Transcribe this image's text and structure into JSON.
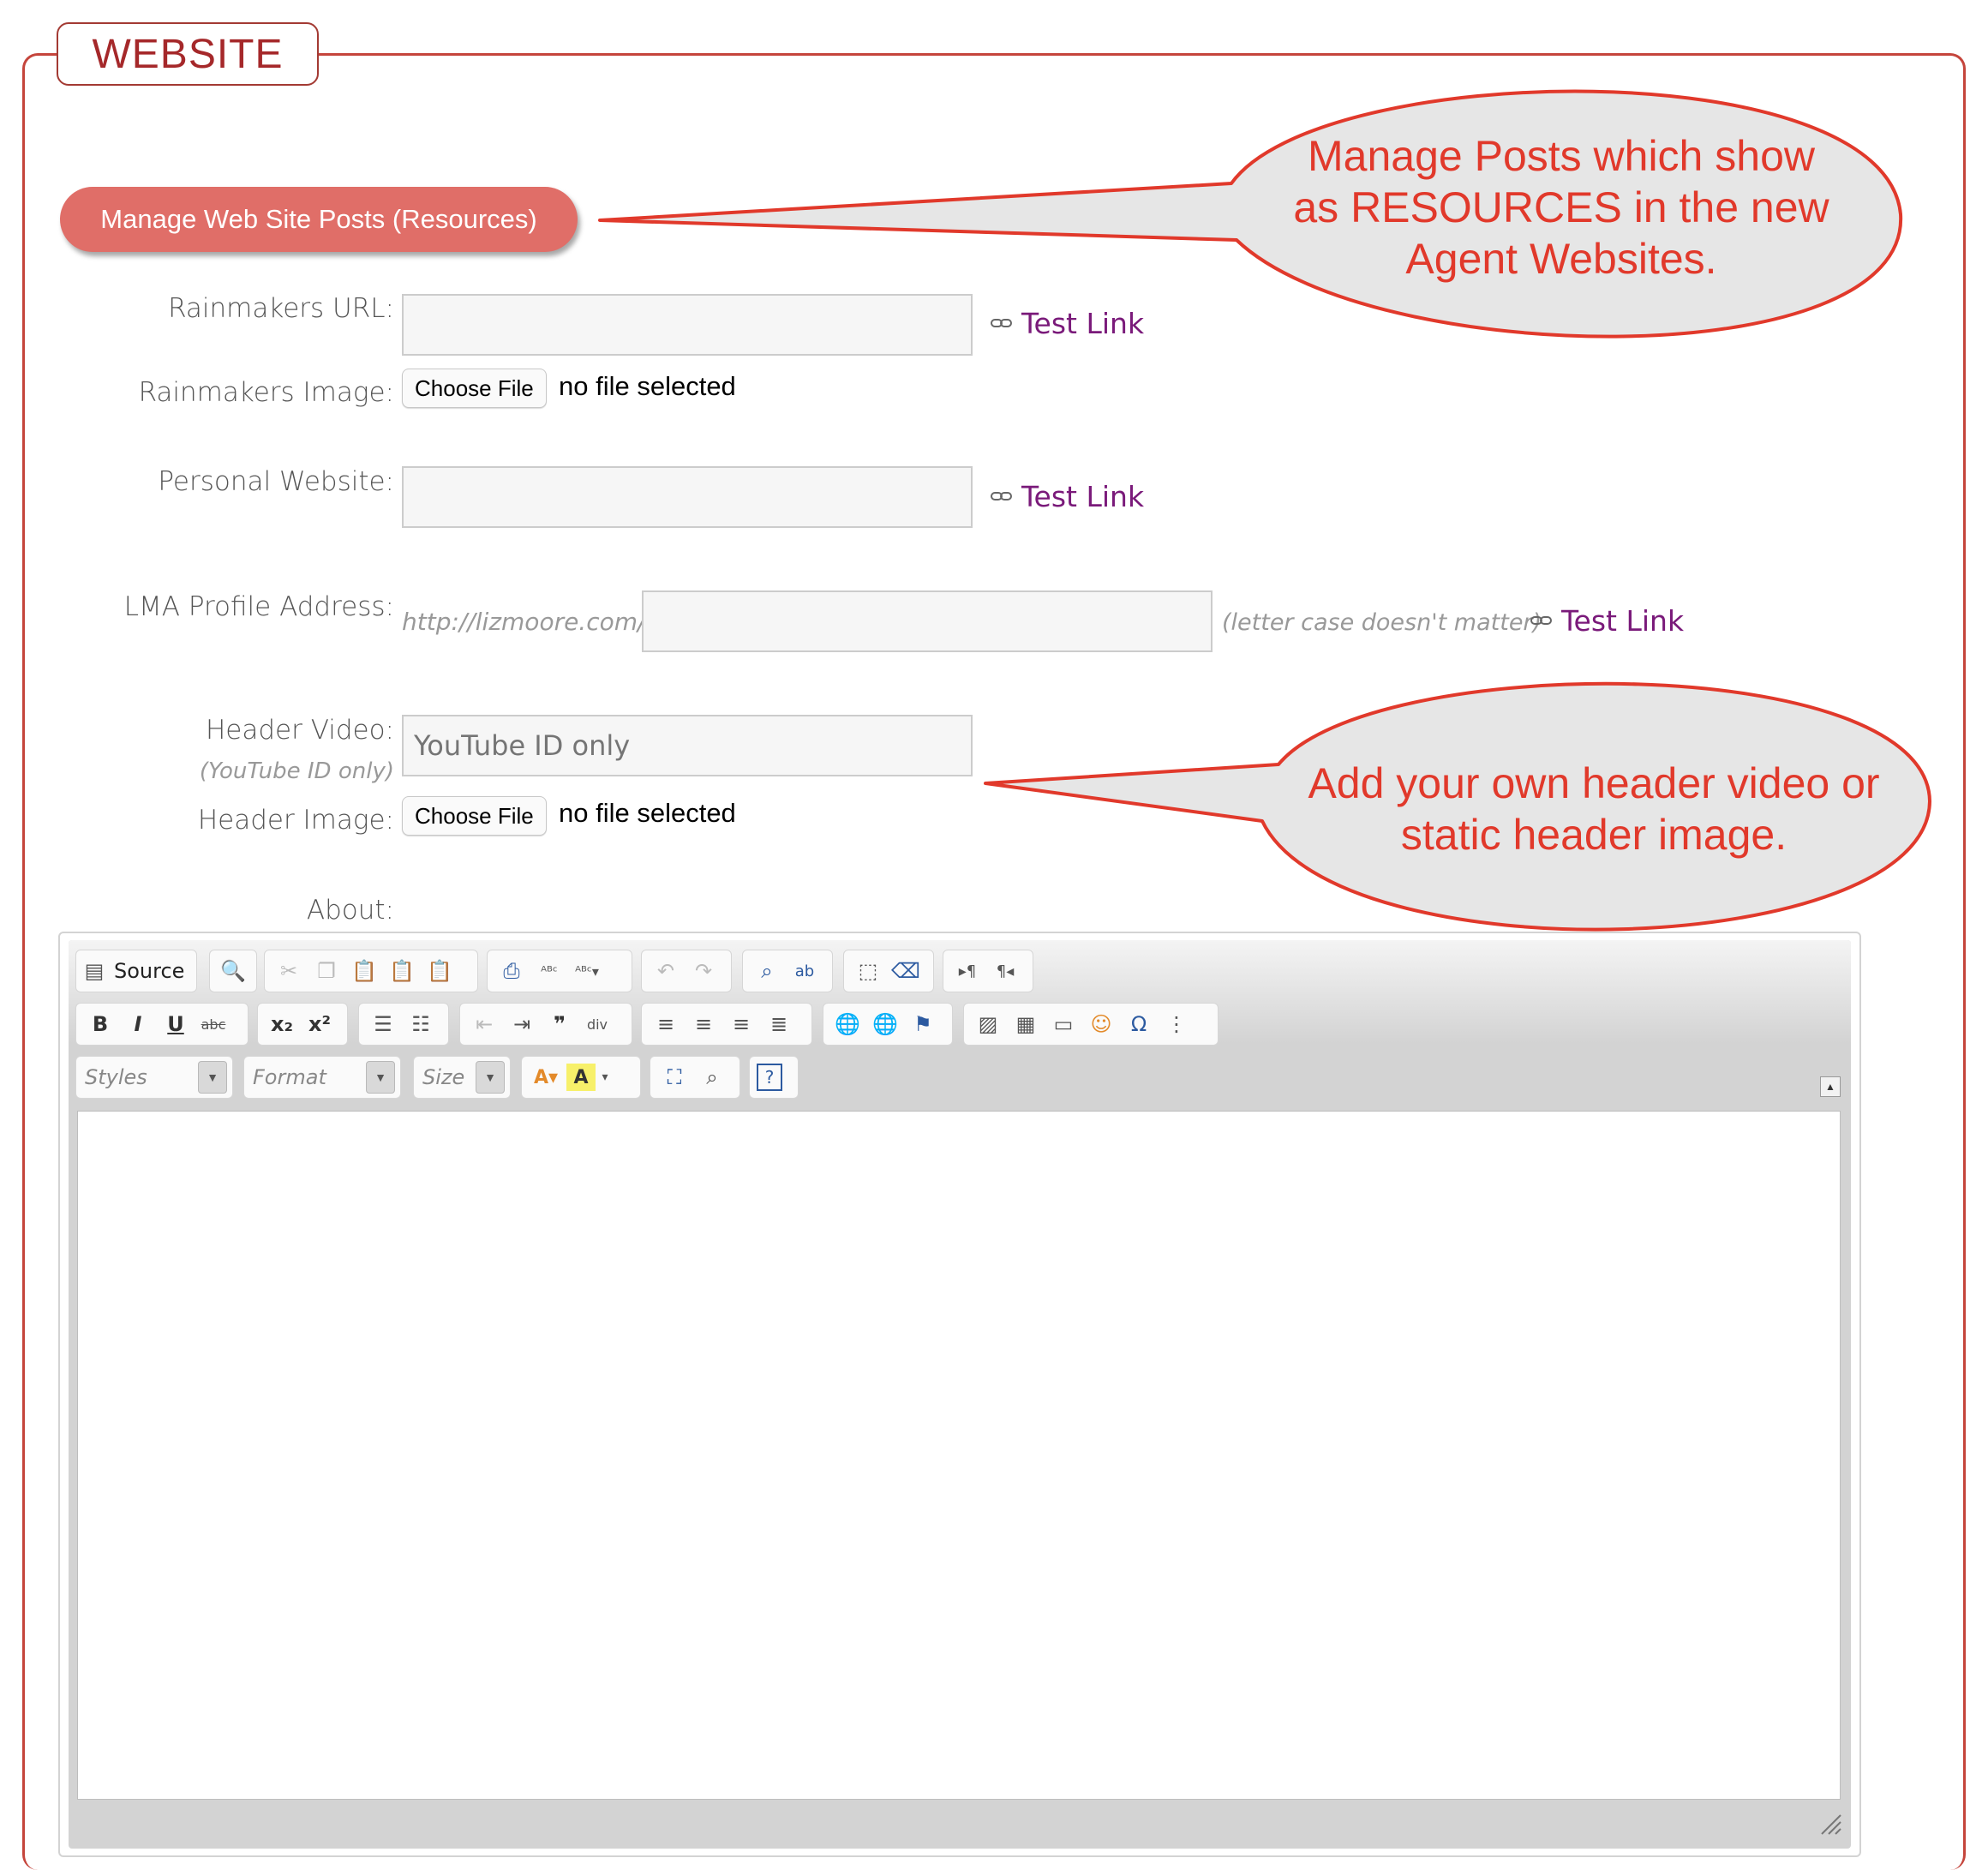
{
  "section": {
    "legend": "WEBSITE"
  },
  "manage_button": {
    "label": "Manage Web Site Posts (Resources)"
  },
  "fields": {
    "rainmakers_url": {
      "label": "Rainmakers URL:",
      "value": "",
      "test_link": "Test Link"
    },
    "rainmakers_image": {
      "label": "Rainmakers Image:",
      "button": "Choose File",
      "status": "no file selected"
    },
    "personal_website": {
      "label": "Personal Website:",
      "value": "",
      "test_link": "Test Link"
    },
    "lma_profile": {
      "label": "LMA Profile Address:",
      "prefix": "http://lizmoore.com/",
      "value": "",
      "note": "(letter case doesn't matter)",
      "test_link": "Test Link"
    },
    "header_video": {
      "label": "Header Video:",
      "sublabel": "(YouTube ID only)",
      "placeholder": "YouTube ID only"
    },
    "header_image": {
      "label": "Header Image:",
      "button": "Choose File",
      "status": "no file selected"
    },
    "about": {
      "label": "About:"
    }
  },
  "editor": {
    "source_label": "Source",
    "combos": {
      "styles": "Styles",
      "format": "Format",
      "size": "Size"
    },
    "content": ""
  },
  "callouts": {
    "posts": [
      "Manage Posts which show",
      "as RESOURCES in the new",
      "Agent Websites."
    ],
    "header": [
      "Add your own header video or",
      "static header image."
    ]
  },
  "colors": {
    "accent": "#c5453c",
    "button": "#e06e68",
    "callout_fill": "#e6e6e6",
    "callout_text": "#e1392b",
    "link": "#7a1a7a"
  }
}
